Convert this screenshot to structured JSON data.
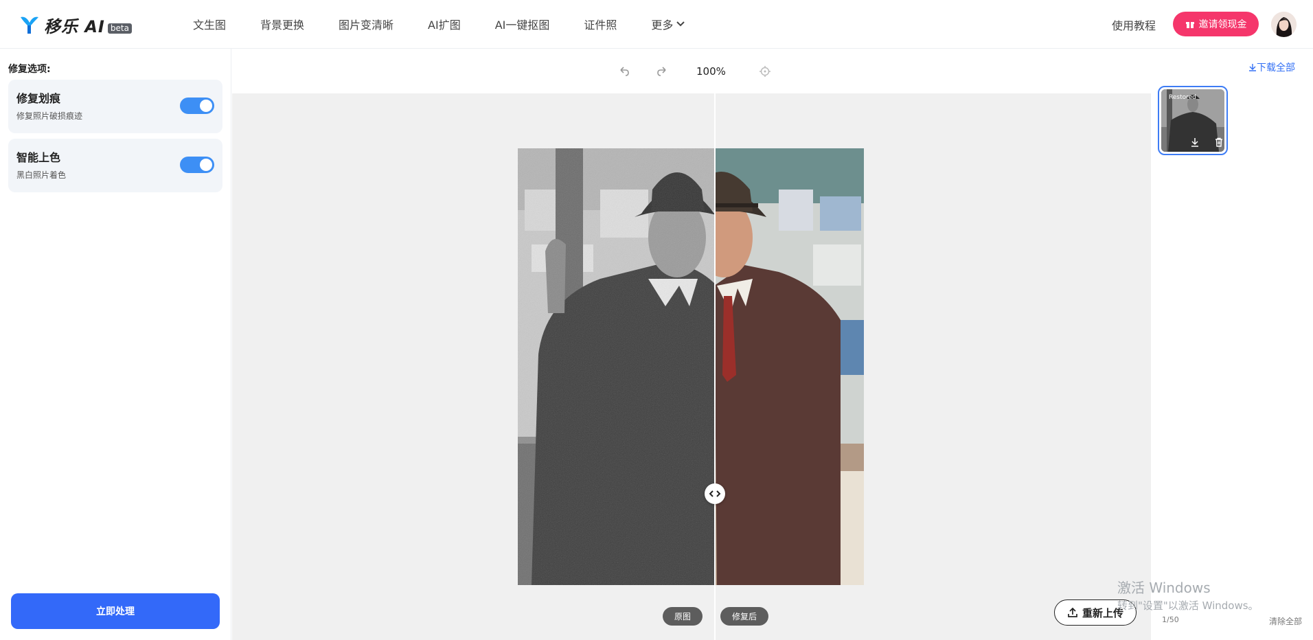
{
  "header": {
    "logo_text": "移乐 AI",
    "logo_badge": "beta",
    "nav": [
      "文生图",
      "背景更换",
      "图片变清晰",
      "AI扩图",
      "AI一键抠图",
      "证件照",
      "更多"
    ],
    "tutorial": "使用教程",
    "invite_button": "邀请领现金",
    "colors": {
      "brand_blue": "#1aa3f5",
      "invite_pink": "#f5366b"
    }
  },
  "sidebar": {
    "title": "修复选项:",
    "options": [
      {
        "title": "修复划痕",
        "desc": "修复照片破损痕迹",
        "enabled": true
      },
      {
        "title": "智能上色",
        "desc": "黑白照片着色",
        "enabled": true
      }
    ],
    "process_button": "立即处理",
    "colors": {
      "toggle": "#3d8ff5",
      "process": "#3369f9"
    }
  },
  "canvas": {
    "zoom": "100%",
    "tag_before": "原图",
    "tag_after": "修复后",
    "reupload": "重新上传",
    "split_fraction": 0.567
  },
  "gallery": {
    "download_all": "下载全部",
    "thumb_label": "Restored",
    "count": "1/50",
    "clear_all": "清除全部"
  },
  "watermark": {
    "line1": "激活 Windows",
    "line2": "转到\"设置\"以激活 Windows。"
  }
}
